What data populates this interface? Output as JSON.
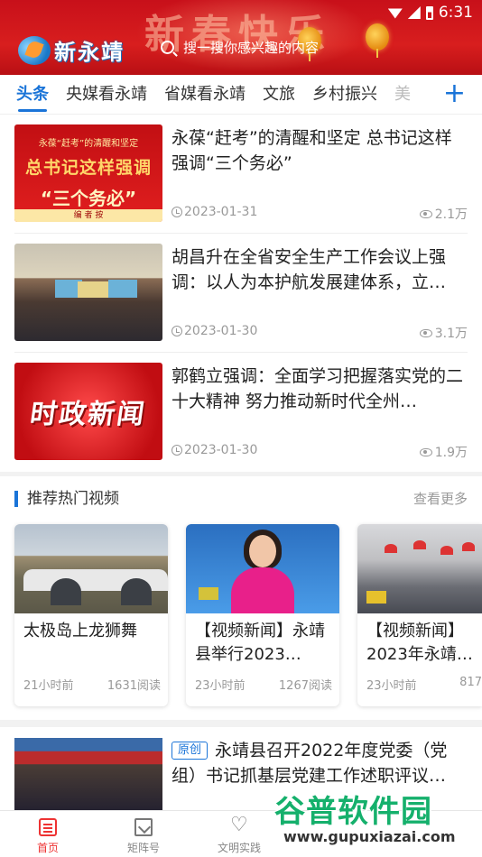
{
  "status_bar": {
    "time": "6:31"
  },
  "banner": {
    "slogan": "新春快乐"
  },
  "header": {
    "logo_text": "新永靖",
    "search_placeholder": "搜一搜你感兴趣的内容"
  },
  "tabs": [
    {
      "label": "头条",
      "active": true
    },
    {
      "label": "央媒看永靖"
    },
    {
      "label": "省媒看永靖"
    },
    {
      "label": "文旅"
    },
    {
      "label": "乡村振兴"
    },
    {
      "label": "美"
    }
  ],
  "add_tab_label": "+",
  "news": [
    {
      "title": "永葆“赶考”的清醒和坚定 总书记这样强调“三个务必”",
      "date": "2023-01-31",
      "views": "2.1万",
      "thumb": {
        "line1": "永葆“赶考”的清醒和坚定",
        "line2": "总书记这样强调",
        "line3": "“三个务必”",
        "line4": "编 者 按"
      }
    },
    {
      "title": "胡昌升在全省安全生产工作会议上强调：以人为本护航发展建体系，立…",
      "date": "2023-01-30",
      "views": "3.1万"
    },
    {
      "title": "郭鹤立强调：全面学习把握落实党的二十大精神 努力推动新时代全州…",
      "date": "2023-01-30",
      "views": "1.9万",
      "thumb": {
        "text": "时政新闻"
      }
    }
  ],
  "videos_section": {
    "title": "推荐热门视频",
    "more": "查看更多",
    "items": [
      {
        "title": "太极岛上龙狮舞",
        "time": "21小时前",
        "reads": "1631阅读"
      },
      {
        "title": "【视频新闻】永靖县举行2023…",
        "time": "23小时前",
        "reads": "1267阅读"
      },
      {
        "title": "【视频新闻】2023年永靖县…",
        "time": "23小时前",
        "reads": "817"
      }
    ]
  },
  "article": {
    "tag": "原创",
    "title": "永靖县召开2022年度党委（党组）书记抓基层党建工作述职评议…"
  },
  "bottom_nav": [
    {
      "label": "首页",
      "icon": "home-icon",
      "active": true
    },
    {
      "label": "矩阵号",
      "icon": "matrix-icon"
    },
    {
      "label": "文明实践",
      "icon": "heart-icon"
    }
  ],
  "watermark": {
    "text": "谷普软件园",
    "url": "www.gupuxiazai.com"
  },
  "colors": {
    "brand_blue": "#1a74d8",
    "banner_red": "#d81e1e",
    "active_nav": "#e33333"
  }
}
